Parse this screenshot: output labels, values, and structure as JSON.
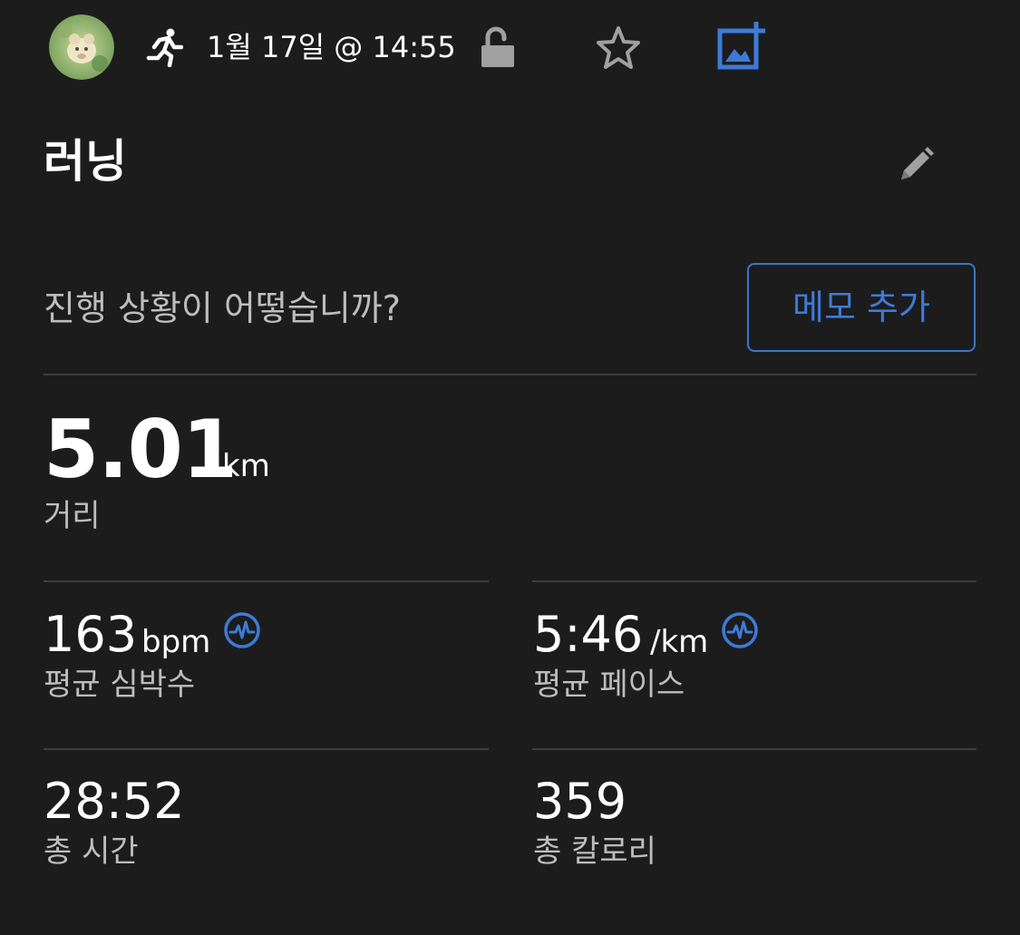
{
  "header": {
    "activity_icon": "running-icon",
    "datetime": "1월 17일 @ 14:55",
    "lock_icon": "unlock-icon",
    "favorite_icon": "star-icon",
    "add_photo_icon": "add-photo-icon"
  },
  "activity": {
    "title": "러닝",
    "edit_icon": "pencil-icon"
  },
  "note": {
    "prompt": "진행 상황이 어떻습니까?",
    "button_label": "메모 추가"
  },
  "distance": {
    "value": "5.01",
    "unit": "km",
    "label": "거리"
  },
  "stats": {
    "heart_rate": {
      "value": "163",
      "unit": "bpm",
      "label": "평균 심박수",
      "icon": "pulse-chart-icon"
    },
    "pace": {
      "value": "5:46",
      "unit": "/km",
      "label": "평균 페이스",
      "icon": "pulse-chart-icon"
    },
    "time": {
      "value": "28:52",
      "label": "총 시간"
    },
    "calories": {
      "value": "359",
      "label": "총 칼로리"
    }
  },
  "colors": {
    "background": "#1c1c1c",
    "accent": "#3d7bd9",
    "text_primary": "#ffffff",
    "text_secondary": "#bdbdbd",
    "divider": "#3d3d3d",
    "icon_gray": "#a0a0a0"
  }
}
